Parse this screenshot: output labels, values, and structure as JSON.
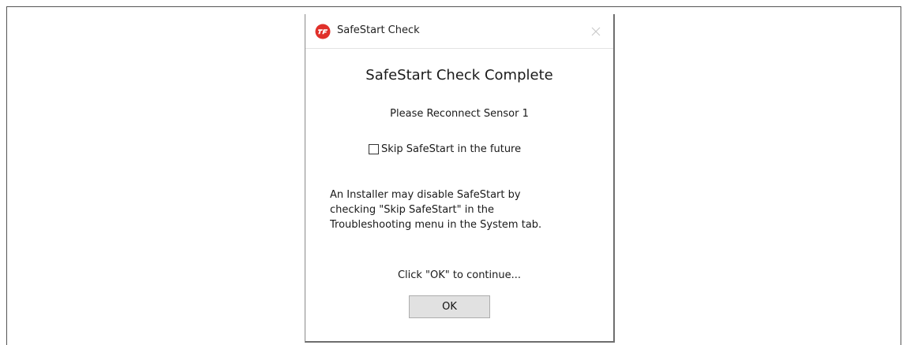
{
  "dialog": {
    "title": "SafeStart Check",
    "icon": "app-logo-icon",
    "close_icon": "close-icon",
    "heading": "SafeStart Check Complete",
    "message": "Please Reconnect Sensor 1",
    "skip_checkbox": {
      "label": "Skip SafeStart in the future",
      "checked": false
    },
    "info_lines": [
      "An Installer may disable SafeStart by",
      "checking \"Skip SafeStart\" in the",
      "Troubleshooting menu in the System tab."
    ],
    "continue_text": "Click \"OK\" to continue...",
    "ok_label": "OK"
  },
  "colors": {
    "icon_red": "#e0302a",
    "button_bg": "#e1e1e1",
    "button_border": "#adadad"
  }
}
